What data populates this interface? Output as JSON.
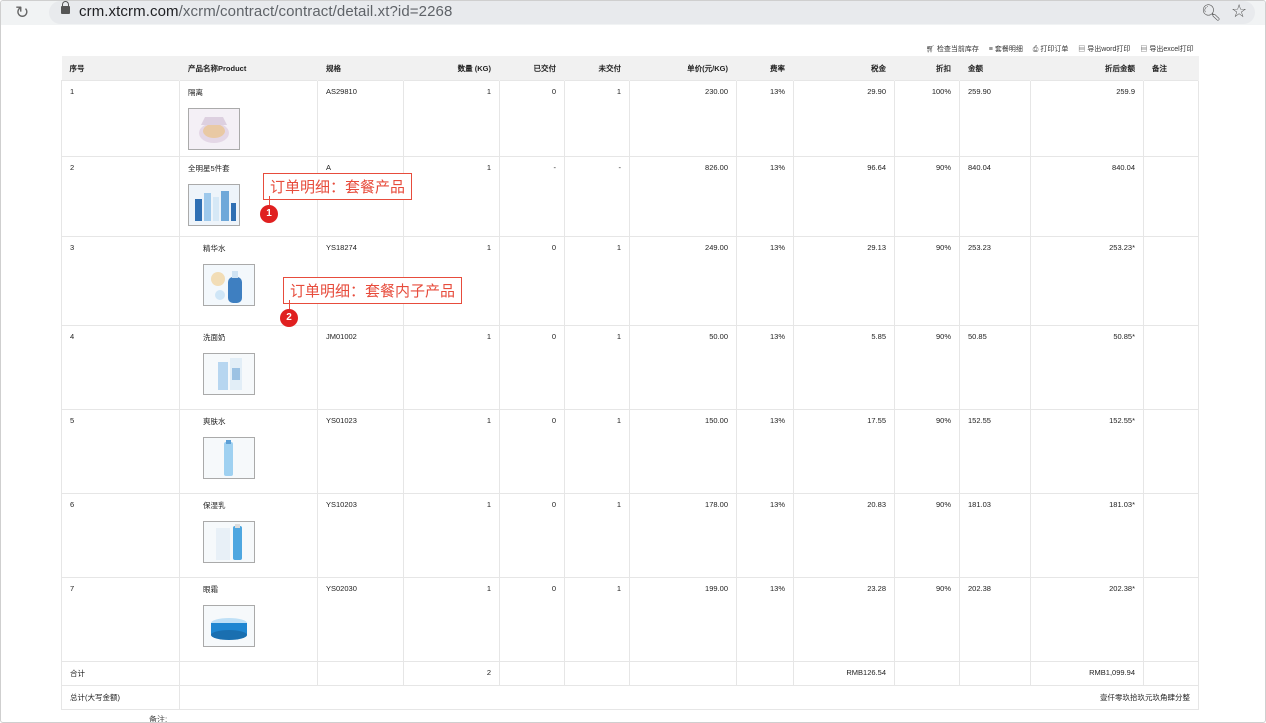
{
  "browser": {
    "host": "crm.xtcrm.com",
    "path": "/xcrm/contract/contract/detail.xt?id=2268"
  },
  "toolbar": [
    "检查当前库存",
    "套餐明细",
    "打印订单",
    "导出word打印",
    "导出excel打印"
  ],
  "columns": [
    "序号",
    "产品名称Product",
    "规格",
    "数量 (KG)",
    "已交付",
    "未交付",
    "单价(元/KG)",
    "费率",
    "税金",
    "折扣",
    "金额",
    "折后金额",
    "备注"
  ],
  "rows": [
    {
      "no": "1",
      "name": "隔离",
      "spec": "AS29810",
      "qty": "1",
      "delivered": "0",
      "undelivered": "1",
      "price": "230.00",
      "rate": "13%",
      "tax": "29.90",
      "discount": "100%",
      "amount": "259.90",
      "net": "259.9",
      "note": "",
      "image": "compact-powder"
    },
    {
      "no": "2",
      "name": "全明星5件套",
      "spec": "A",
      "qty": "1",
      "delivered": "-",
      "undelivered": "-",
      "price": "826.00",
      "rate": "13%",
      "tax": "96.64",
      "discount": "90%",
      "amount": "840.04",
      "net": "840.04",
      "note": "",
      "image": "skincare-set"
    },
    {
      "no": "3",
      "name": "精华水",
      "spec": "YS18274",
      "qty": "1",
      "delivered": "0",
      "undelivered": "1",
      "price": "249.00",
      "rate": "13%",
      "tax": "29.13",
      "discount": "90%",
      "amount": "253.23",
      "net": "253.23*",
      "note": "",
      "image": "essence-bottle"
    },
    {
      "no": "4",
      "name": "洗面奶",
      "spec": "JM01002",
      "qty": "1",
      "delivered": "0",
      "undelivered": "1",
      "price": "50.00",
      "rate": "13%",
      "tax": "5.85",
      "discount": "90%",
      "amount": "50.85",
      "net": "50.85*",
      "note": "",
      "image": "cleanser-tube"
    },
    {
      "no": "5",
      "name": "爽肤水",
      "spec": "YS01023",
      "qty": "1",
      "delivered": "0",
      "undelivered": "1",
      "price": "150.00",
      "rate": "13%",
      "tax": "17.55",
      "discount": "90%",
      "amount": "152.55",
      "net": "152.55*",
      "note": "",
      "image": "toner-bottle"
    },
    {
      "no": "6",
      "name": "保湿乳",
      "spec": "YS10203",
      "qty": "1",
      "delivered": "0",
      "undelivered": "1",
      "price": "178.00",
      "rate": "13%",
      "tax": "20.83",
      "discount": "90%",
      "amount": "181.03",
      "net": "181.03*",
      "note": "",
      "image": "lotion-bottle"
    },
    {
      "no": "7",
      "name": "眼霜",
      "spec": "YS02030",
      "qty": "1",
      "delivered": "0",
      "undelivered": "1",
      "price": "199.00",
      "rate": "13%",
      "tax": "23.28",
      "discount": "90%",
      "amount": "202.38",
      "net": "202.38*",
      "note": "",
      "image": "eye-cream-jar"
    }
  ],
  "summary": {
    "label": "合计",
    "qty": "2",
    "tax": "RMB126.54",
    "net": "RMB1,099.94"
  },
  "total_caps": {
    "label": "总计(大写金额)",
    "value": "壹仟零玖拾玖元玖角肆分整"
  },
  "annotations": [
    {
      "badge": "1",
      "text": "订单明细：套餐产品"
    },
    {
      "badge": "2",
      "text": "订单明细：套餐内子产品"
    }
  ],
  "bottom_note": "备注:"
}
